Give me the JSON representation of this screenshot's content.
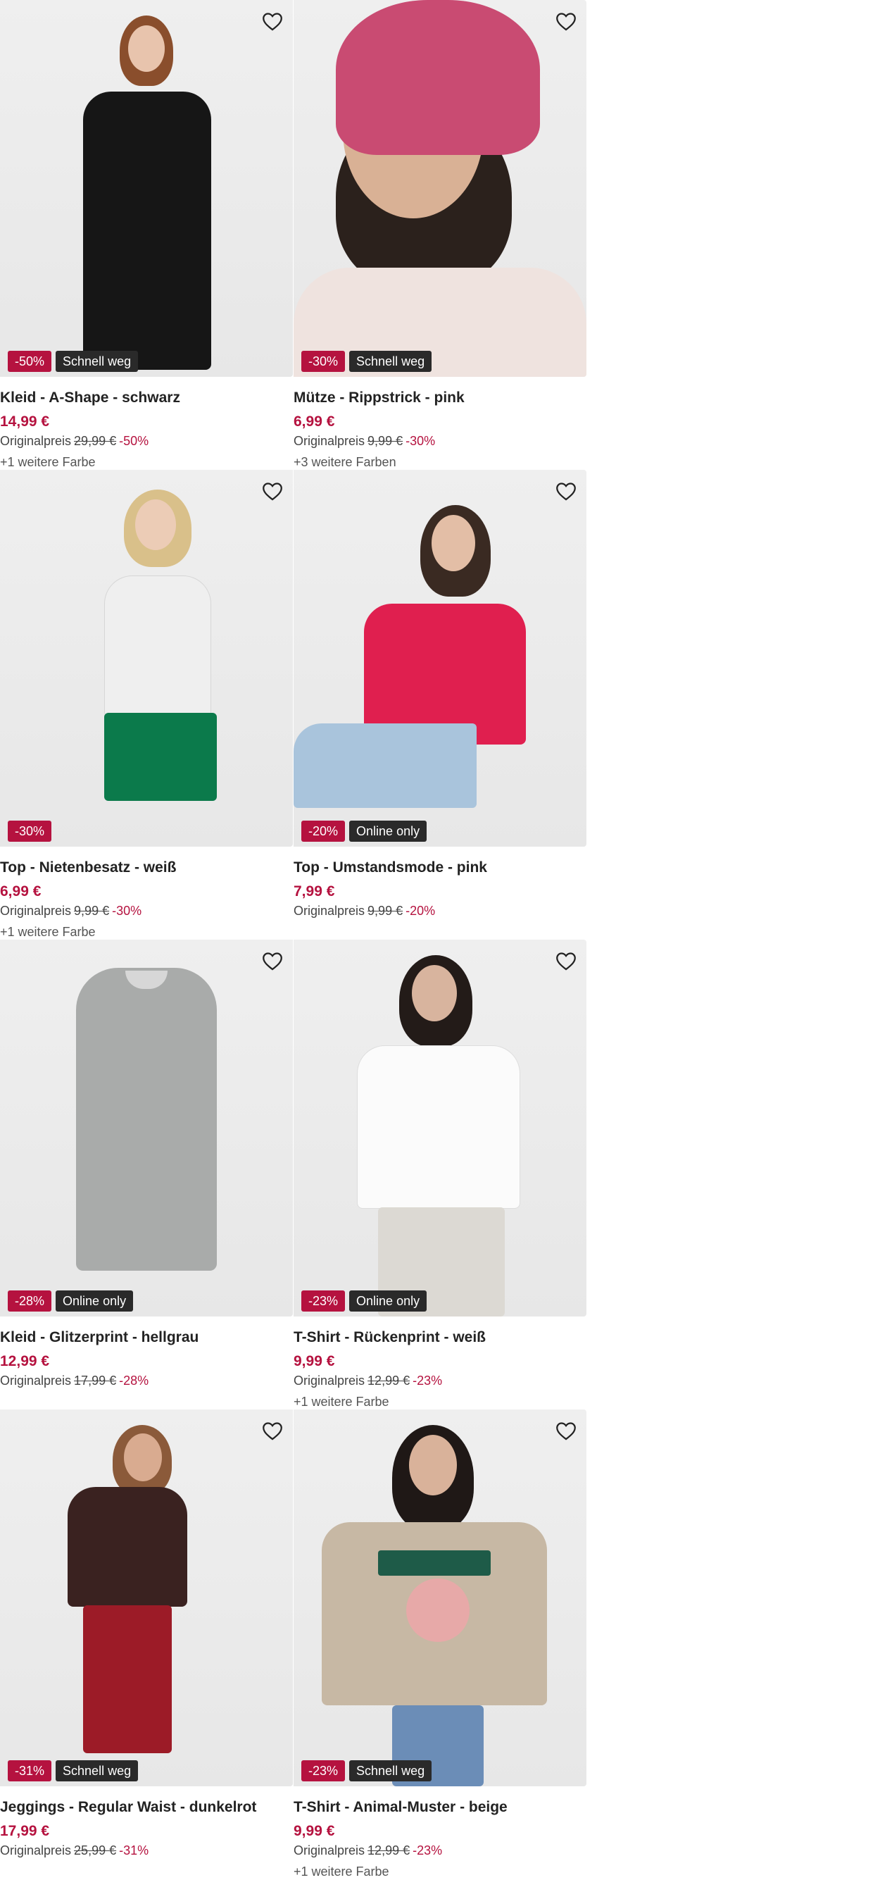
{
  "products": [
    {
      "title": "Kleid - A-Shape - schwarz",
      "price": "14,99 €",
      "original_label": "Originalpreis",
      "original_price": "29,99 €",
      "discount": "-50%",
      "more_colors": "+1 weitere Farbe",
      "sale_badge": "-50%",
      "tag_badge": "Schnell weg"
    },
    {
      "title": "Mütze - Rippstrick - pink",
      "price": "6,99 €",
      "original_label": "Originalpreis",
      "original_price": "9,99 €",
      "discount": "-30%",
      "more_colors": "+3 weitere Farben",
      "sale_badge": "-30%",
      "tag_badge": "Schnell weg"
    },
    {
      "title": "Top - Nietenbesatz - weiß",
      "price": "6,99 €",
      "original_label": "Originalpreis",
      "original_price": "9,99 €",
      "discount": "-30%",
      "more_colors": "+1 weitere Farbe",
      "sale_badge": "-30%",
      "tag_badge": ""
    },
    {
      "title": "Top - Umstandsmode - pink",
      "price": "7,99 €",
      "original_label": "Originalpreis",
      "original_price": "9,99 €",
      "discount": "-20%",
      "more_colors": "",
      "sale_badge": "-20%",
      "tag_badge": "Online only"
    },
    {
      "title": "Kleid - Glitzerprint - hellgrau",
      "price": "12,99 €",
      "original_label": "Originalpreis",
      "original_price": "17,99 €",
      "discount": "-28%",
      "more_colors": "",
      "sale_badge": "-28%",
      "tag_badge": "Online only"
    },
    {
      "title": "T-Shirt - Rückenprint - weiß",
      "price": "9,99 €",
      "original_label": "Originalpreis",
      "original_price": "12,99 €",
      "discount": "-23%",
      "more_colors": "+1 weitere Farbe",
      "sale_badge": "-23%",
      "tag_badge": "Online only"
    },
    {
      "title": "Jeggings - Regular Waist - dunkelrot",
      "price": "17,99 €",
      "original_label": "Originalpreis",
      "original_price": "25,99 €",
      "discount": "-31%",
      "more_colors": "",
      "sale_badge": "-31%",
      "tag_badge": "Schnell weg"
    },
    {
      "title": "T-Shirt - Animal-Muster - beige",
      "price": "9,99 €",
      "original_label": "Originalpreis",
      "original_price": "12,99 €",
      "discount": "-23%",
      "more_colors": "+1 weitere Farbe",
      "sale_badge": "-23%",
      "tag_badge": "Schnell weg"
    }
  ],
  "colors": {
    "sale_red": "#b5123f",
    "tag_dark": "#2a2a2a",
    "image_bg": "#ececec"
  },
  "icons": {
    "wishlist": "heart-outline-icon"
  }
}
